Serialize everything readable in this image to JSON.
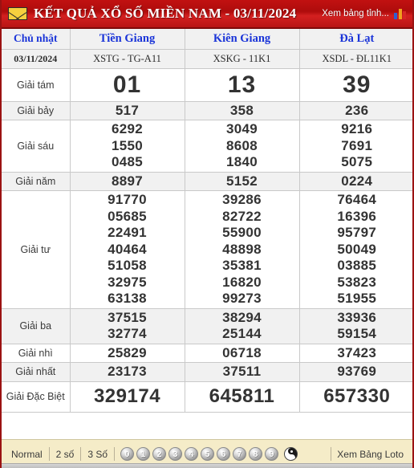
{
  "header": {
    "envelope_icon": "envelope-icon",
    "title": "KẾT QUẢ XỔ SỐ MIỀN NAM - 03/11/2024",
    "link_label": "Xem bảng tỉnh...",
    "chart_icon": "bar-chart-icon",
    "background_color": "#be1414",
    "title_color": "#ffffff"
  },
  "table": {
    "day_label": "Chủ nhật",
    "date": "03/11/2024",
    "provinces": [
      "Tiền Giang",
      "Kiên Giang",
      "Đà Lạt"
    ],
    "codes": [
      "XSTG - TG-A11",
      "XSKG - 11K1",
      "XSDL - ĐL11K1"
    ],
    "province_color": "#1a34d8",
    "highlight_color": "#8c0f16",
    "rows": [
      {
        "label": "Giải tám",
        "style": "big",
        "values": [
          [
            "01"
          ],
          [
            "13"
          ],
          [
            "39"
          ]
        ]
      },
      {
        "label": "Giải bảy",
        "style": "num",
        "values": [
          [
            "517"
          ],
          [
            "358"
          ],
          [
            "236"
          ]
        ]
      },
      {
        "label": "Giải sáu",
        "style": "num",
        "values": [
          [
            "6292",
            "1550",
            "0485"
          ],
          [
            "3049",
            "8608",
            "1840"
          ],
          [
            "9216",
            "7691",
            "5075"
          ]
        ]
      },
      {
        "label": "Giải năm",
        "style": "num",
        "values": [
          [
            "8897"
          ],
          [
            "5152"
          ],
          [
            "0224"
          ]
        ]
      },
      {
        "label": "Giải tư",
        "style": "num",
        "values": [
          [
            "91770",
            "05685",
            "22491",
            "40464",
            "51058",
            "32975",
            "63138"
          ],
          [
            "39286",
            "82722",
            "55900",
            "48898",
            "35381",
            "16820",
            "99273"
          ],
          [
            "76464",
            "16396",
            "95797",
            "50049",
            "03885",
            "53823",
            "51955"
          ]
        ]
      },
      {
        "label": "Giải ba",
        "style": "num",
        "values": [
          [
            "37515",
            "32774"
          ],
          [
            "38294",
            "25144"
          ],
          [
            "33936",
            "59154"
          ]
        ]
      },
      {
        "label": "Giải nhì",
        "style": "num",
        "values": [
          [
            "25829"
          ],
          [
            "06718"
          ],
          [
            "37423"
          ]
        ]
      },
      {
        "label": "Giải nhất",
        "style": "num",
        "values": [
          [
            "23173"
          ],
          [
            "37511"
          ],
          [
            "93769"
          ]
        ]
      },
      {
        "label": "Giải Đặc Biệt",
        "style": "special",
        "values": [
          [
            "329174"
          ],
          [
            "645811"
          ],
          [
            "657330"
          ]
        ]
      }
    ]
  },
  "footer": {
    "tabs": [
      "Normal",
      "2 số",
      "3 Số"
    ],
    "balls": [
      "0",
      "1",
      "2",
      "3",
      "4",
      "5",
      "6",
      "7",
      "8",
      "9"
    ],
    "yin_yang_icon": "yin-yang-icon",
    "loto_link": "Xem Bảng Loto",
    "background_color": "#f5ecc8"
  }
}
